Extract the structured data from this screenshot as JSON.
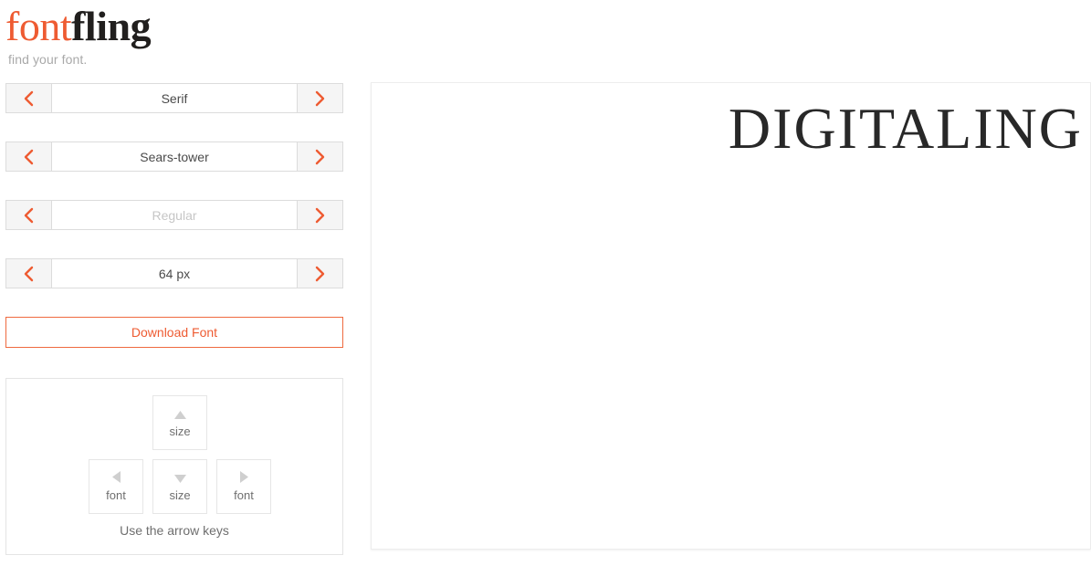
{
  "logo": {
    "part1": "font",
    "part2": "fling",
    "tagline": "find your font."
  },
  "colors": {
    "accent": "#ee5b32",
    "accent_border": "#ef6a3f",
    "text": "#4a4a4a",
    "muted": "#c6c6c6",
    "panel_border": "#e4e4e4"
  },
  "selectors": [
    {
      "name": "category",
      "value": "Serif",
      "muted": false,
      "prev_icon": "chevron-left-icon",
      "next_icon": "chevron-right-icon"
    },
    {
      "name": "family",
      "value": "Sears-tower",
      "muted": false,
      "prev_icon": "chevron-left-icon",
      "next_icon": "chevron-right-icon"
    },
    {
      "name": "weight",
      "value": "Regular",
      "muted": true,
      "prev_icon": "chevron-left-icon",
      "next_icon": "chevron-right-icon"
    },
    {
      "name": "size",
      "value": "64 px",
      "muted": false,
      "prev_icon": "chevron-left-icon",
      "next_icon": "chevron-right-icon"
    }
  ],
  "download": {
    "label": "Download Font"
  },
  "keys_panel": {
    "hint": "Use the arrow keys",
    "keys": [
      {
        "position": "up",
        "icon": "triangle-up-icon",
        "label": "size"
      },
      {
        "position": "left",
        "icon": "triangle-left-icon",
        "label": "font"
      },
      {
        "position": "down",
        "icon": "triangle-down-icon",
        "label": "size"
      },
      {
        "position": "right",
        "icon": "triangle-right-icon",
        "label": "font"
      }
    ]
  },
  "preview": {
    "text": "DIGITALING",
    "font_size_px": "64 px",
    "font_family_label": "Sears-tower"
  }
}
